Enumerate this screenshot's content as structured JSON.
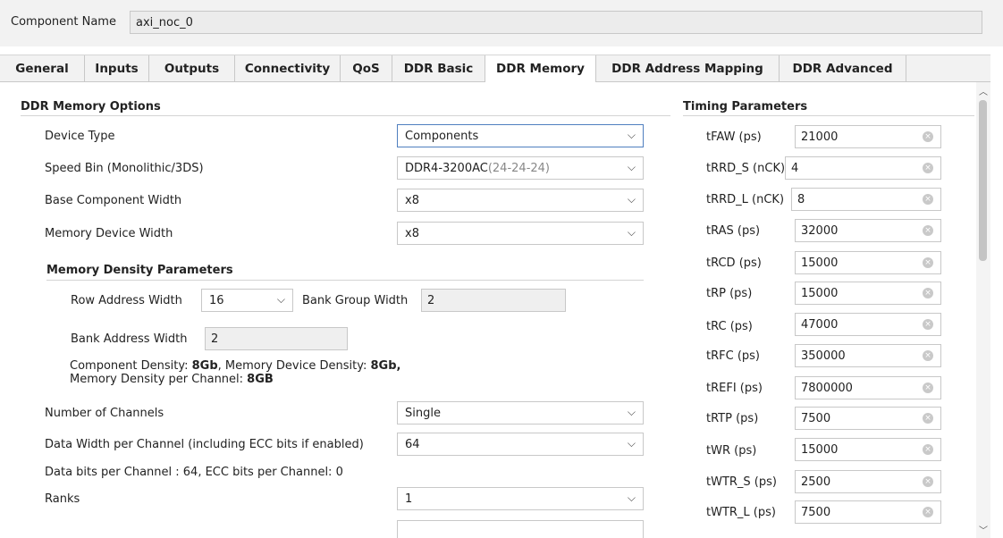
{
  "component": {
    "label": "Component Name",
    "value": "axi_noc_0"
  },
  "tabs": [
    {
      "label": "General"
    },
    {
      "label": "Inputs"
    },
    {
      "label": "Outputs"
    },
    {
      "label": "Connectivity"
    },
    {
      "label": "QoS"
    },
    {
      "label": "DDR Basic"
    },
    {
      "label": "DDR Memory",
      "active": true
    },
    {
      "label": "DDR Address Mapping"
    },
    {
      "label": "DDR Advanced"
    }
  ],
  "memory_options": {
    "title": "DDR Memory Options",
    "device_type": {
      "label": "Device Type",
      "value": "Components"
    },
    "speed_bin": {
      "label": "Speed Bin (Monolithic/3DS)",
      "value": "DDR4-3200AC",
      "suffix": "(24-24-24)"
    },
    "base_width": {
      "label": "Base Component Width",
      "value": "x8"
    },
    "device_width": {
      "label": "Memory Device Width",
      "value": "x8"
    }
  },
  "density": {
    "title": "Memory Density Parameters",
    "row_addr": {
      "label": "Row Address Width",
      "value": "16"
    },
    "bank_group": {
      "label": "Bank Group Width",
      "value": "2"
    },
    "bank_addr": {
      "label": "Bank Address Width",
      "value": "2"
    },
    "info": {
      "comp_label": "Component Density: ",
      "comp_value": "8Gb",
      "dev_label": ", Memory Device Density: ",
      "dev_value": "8Gb,",
      "chan_label": "Memory Density per Channel: ",
      "chan_value": "8GB"
    }
  },
  "channels": {
    "label": "Number of Channels",
    "value": "Single"
  },
  "data_width": {
    "label": "Data Width per Channel (including ECC bits if enabled)",
    "value": "64"
  },
  "data_bits_info": "Data bits per Channel : 64, ECC bits per Channel: 0",
  "ranks": {
    "label": "Ranks",
    "value": "1"
  },
  "timing": {
    "title": "Timing Parameters",
    "params": [
      {
        "label": "tFAW (ps)",
        "value": "21000"
      },
      {
        "label": "tRRD_S (nCK)",
        "value": "4"
      },
      {
        "label": "tRRD_L (nCK)",
        "value": "8"
      },
      {
        "label": "tRAS (ps)",
        "value": "32000"
      },
      {
        "label": "tRCD (ps)",
        "value": "15000"
      },
      {
        "label": "tRP (ps)",
        "value": "15000"
      },
      {
        "label": "tRC (ps)",
        "value": "47000"
      },
      {
        "label": "tRFC (ps)",
        "value": "350000"
      },
      {
        "label": "tREFI (ps)",
        "value": "7800000"
      },
      {
        "label": "tRTP (ps)",
        "value": "7500"
      },
      {
        "label": "tWR (ps)",
        "value": "15000"
      },
      {
        "label": "tWTR_S (ps)",
        "value": "2500"
      },
      {
        "label": "tWTR_L (ps)",
        "value": "7500"
      }
    ]
  },
  "icons": {
    "dropdown": "chevron-down-icon",
    "clear": "clear-circle-icon",
    "scroll_up": "scroll-up-icon",
    "scroll_down": "scroll-down-icon"
  }
}
